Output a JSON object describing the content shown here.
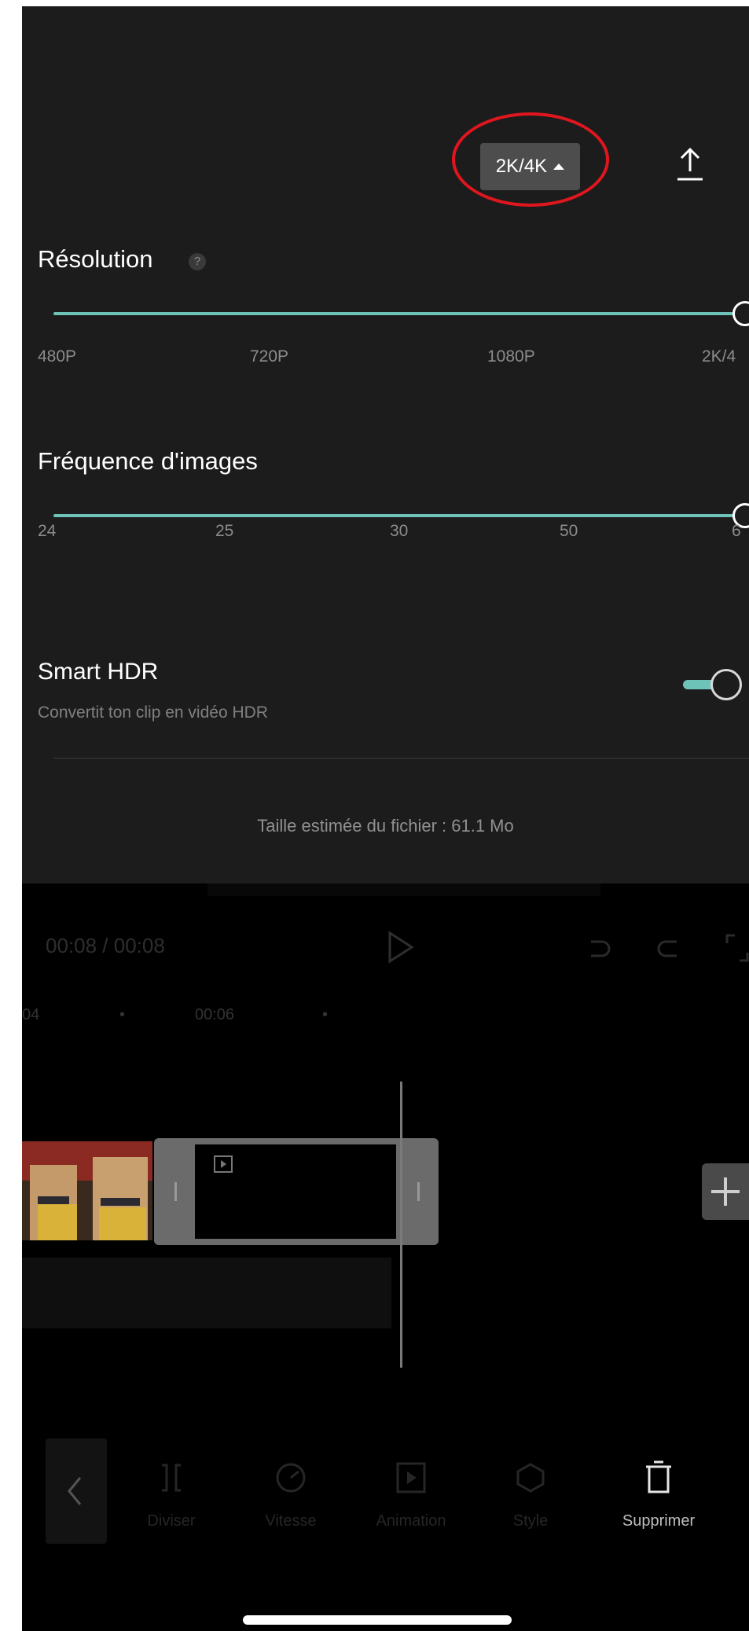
{
  "header": {
    "quality_button": "2K/4K",
    "export_icon": "upload-icon"
  },
  "resolution": {
    "title": "Résolution",
    "help": "?",
    "ticks": [
      "480P",
      "720P",
      "1080P",
      "2K/4"
    ],
    "value": "2K/4K",
    "fraction": 1.0
  },
  "frame_rate": {
    "title": "Fréquence d'images",
    "ticks": [
      "24",
      "25",
      "30",
      "50",
      "6"
    ],
    "value": "60",
    "fraction": 1.0
  },
  "smart_hdr": {
    "title": "Smart HDR",
    "subtitle": "Convertit ton clip en vidéo HDR",
    "enabled": true
  },
  "file_size": "Taille estimée du fichier : 61.1 Mo",
  "player": {
    "current": "00:08",
    "separator": " / ",
    "total": "00:08"
  },
  "timeline": {
    "ruler": [
      "04",
      "•",
      "00:06",
      "•"
    ]
  },
  "toolbar": {
    "items": [
      "Diviser",
      "Vitesse",
      "Animation",
      "Style",
      "Supprimer"
    ]
  },
  "colors": {
    "accent": "#6ec3b9",
    "highlight_ring": "#e0161f",
    "panel": "#1c1c1c"
  }
}
